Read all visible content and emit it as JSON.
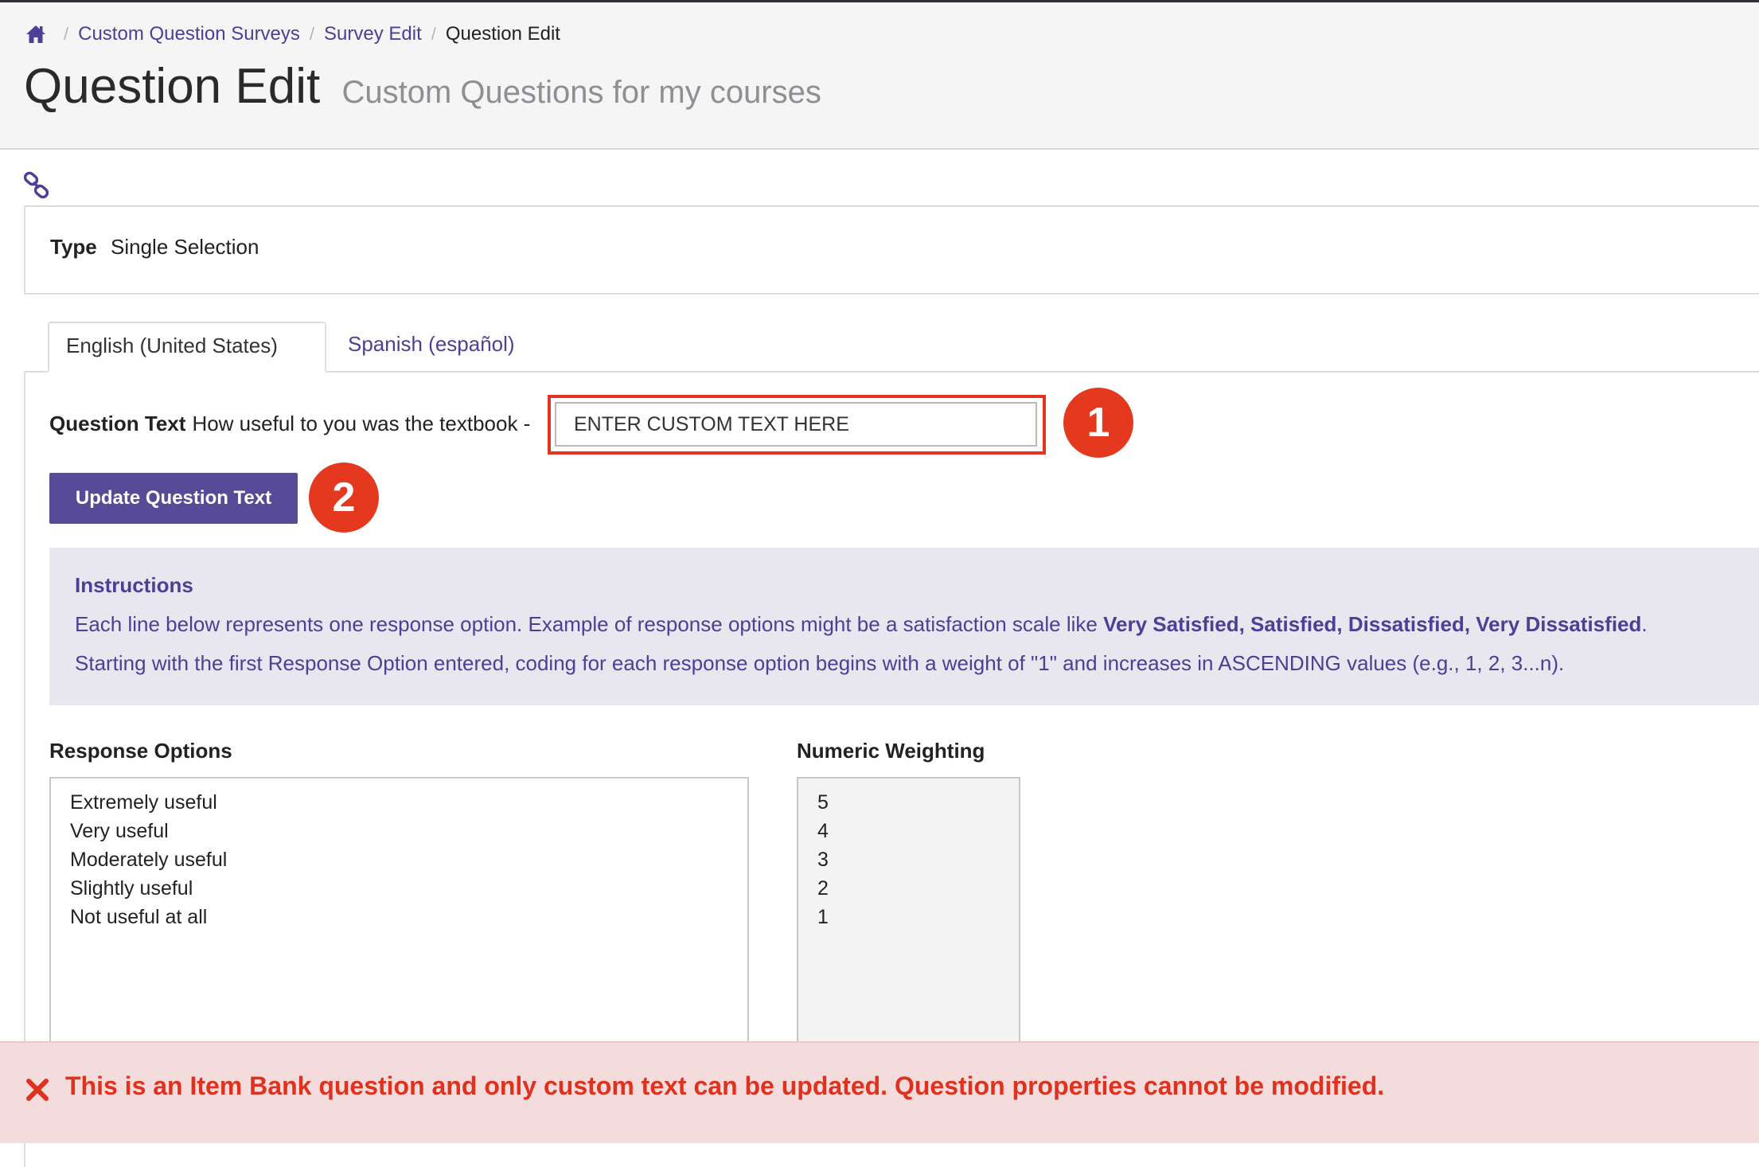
{
  "breadcrumb": {
    "home_icon": "home-icon",
    "items": [
      {
        "label": "Custom Question Surveys"
      },
      {
        "label": "Survey Edit"
      },
      {
        "label": "Question Edit"
      }
    ],
    "separator": "/"
  },
  "header": {
    "title": "Question Edit",
    "subtitle": "Custom Questions for my courses"
  },
  "link_icon": "link-icon",
  "type_panel": {
    "label": "Type",
    "value": "Single Selection"
  },
  "tabs": [
    {
      "label": "English (United States)",
      "active": true
    },
    {
      "label": "Spanish (español)",
      "active": false
    }
  ],
  "question": {
    "label": "Question Text",
    "text": "How useful to you was the textbook -",
    "custom_value": "ENTER CUSTOM TEXT HERE"
  },
  "badges": {
    "one": "1",
    "two": "2"
  },
  "update_button": {
    "label": "Update Question Text"
  },
  "instructions": {
    "title": "Instructions",
    "line1_prefix": "Each line below represents one response option. Example of response options might be a satisfaction scale like ",
    "line1_bold": "Very Satisfied, Satisfied, Dissatisfied, Very Dissatisfied",
    "line1_suffix": ".",
    "line2": "Starting with the first Response Option entered, coding for each response option begins with a weight of \"1\" and increases in ASCENDING values (e.g., 1, 2, 3...n)."
  },
  "response_options": {
    "label": "Response Options",
    "items": [
      "Extremely useful",
      "Very useful",
      "Moderately useful",
      "Slightly useful",
      "Not useful at all"
    ]
  },
  "numeric_weighting": {
    "label": "Numeric Weighting",
    "items": [
      "5",
      "4",
      "3",
      "2",
      "1"
    ]
  },
  "error": {
    "icon": "close-icon",
    "message": "This is an Item Bank question and only custom text can be updated. Question properties cannot be modified."
  },
  "colors": {
    "accent": "#4a4196",
    "button": "#574b97",
    "badge": "#e4391f",
    "error_text": "#e0301e",
    "error_bg": "#f5dcdc",
    "instructions_bg": "#e8e7ef"
  }
}
